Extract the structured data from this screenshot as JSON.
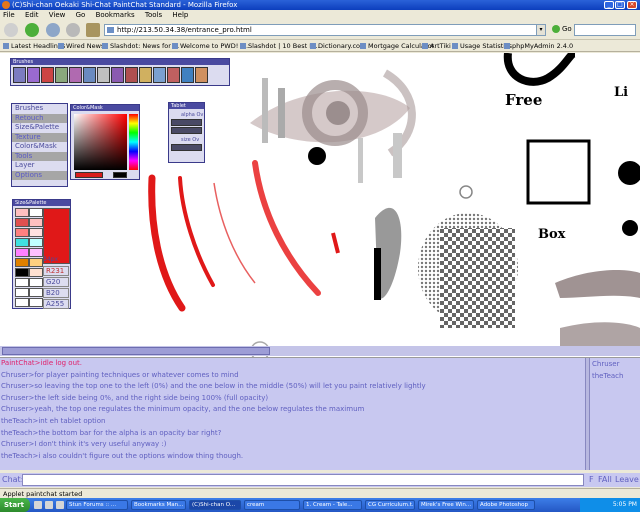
{
  "window": {
    "title": "(C)Shi-chan Oekaki Shi-Chat PaintChat Standard - Mozilla Firefox"
  },
  "menu": [
    "File",
    "Edit",
    "View",
    "Go",
    "Bookmarks",
    "Tools",
    "Help"
  ],
  "nav": {
    "url": "http://213.50.34.38/entrance_pro.html",
    "go_label": "Go"
  },
  "bookmarks": [
    "Latest Headlines",
    "Wired News",
    "Slashdot: News for ...",
    "Welcome to PWD! -...",
    "Slashdot | 10 Best R...",
    "Dictionary.com",
    "Mortgage Calculator",
    "ArtTiki",
    "Usage Statistics",
    "phpMyAdmin 2.4.0"
  ],
  "palettes": {
    "brushes_title": "Brushes",
    "menu_items": [
      "Brushes",
      "Retouch",
      "Size&Palette",
      "Texture",
      "Color&Mask",
      "Tools",
      "Layer",
      "Options"
    ],
    "colormask_title": "Color&Mask",
    "tablet_title": "Tablet",
    "tablet_alpha_label": "alpha Ov",
    "tablet_size_label": "size Ov",
    "size_title": "Size&Palette",
    "size_px": "34px",
    "rgb": [
      "R231",
      "G20",
      "B20",
      "A255"
    ],
    "swatches": [
      "#ffc0c0",
      "#ffffff",
      "#e05050",
      "#ffc0c0",
      "#ff8080",
      "#ffe0e0",
      "#40e0e0",
      "#c0ffff",
      "#ff80ff",
      "#ffc0ff",
      "#e08000",
      "#ffd080",
      "#000000",
      "#ffe0d0",
      "#ffffff",
      "#ffffff",
      "#ffffff",
      "#ffffff",
      "#ffffff",
      "#ffffff"
    ]
  },
  "canvas_text": {
    "free": "Free",
    "box": "Box",
    "li": "Li"
  },
  "chat": {
    "lines": [
      {
        "text": "PaintChat>idle log out.",
        "sys": true
      },
      {
        "text": "Chruser>for player painting techniques or whatever comes to mind",
        "sys": false
      },
      {
        "text": "Chruser>so leaving the top one to the left (0%) and the one below in the middle (50%) will let you paint relatively lightly",
        "sys": false
      },
      {
        "text": "Chruser>the left side being 0%, and the right side being 100% (full opacity)",
        "sys": false
      },
      {
        "text": "Chruser>yeah, the top one regulates the minimum opacity, and the one below regulates the maximum",
        "sys": false
      },
      {
        "text": "theTeach>int eh tablet option",
        "sys": false
      },
      {
        "text": "theTeach>the bottom bar for the alpha is an opacity bar right?",
        "sys": false
      },
      {
        "text": "Chruser>I don't think it's very useful anyway :)",
        "sys": false
      },
      {
        "text": "theTeach>i also couldn't figure out the options window thing though.",
        "sys": false
      }
    ],
    "users": [
      "Chruser",
      "theTeach"
    ],
    "label": "Chat:",
    "buttons": [
      "F",
      "FAll",
      "Leave"
    ]
  },
  "status": "Applet paintchat started",
  "taskbar": {
    "start": "Start",
    "items": [
      "Stun Forums :: ...",
      "Bookmarks Man...",
      "(C)Shi-chan O...",
      "cream",
      "1. Cream - Tale...",
      "CG Curriculum.t...",
      "Mirek's Free Win...",
      "Adobe Photoshop"
    ],
    "clock": "5:05 PM"
  }
}
